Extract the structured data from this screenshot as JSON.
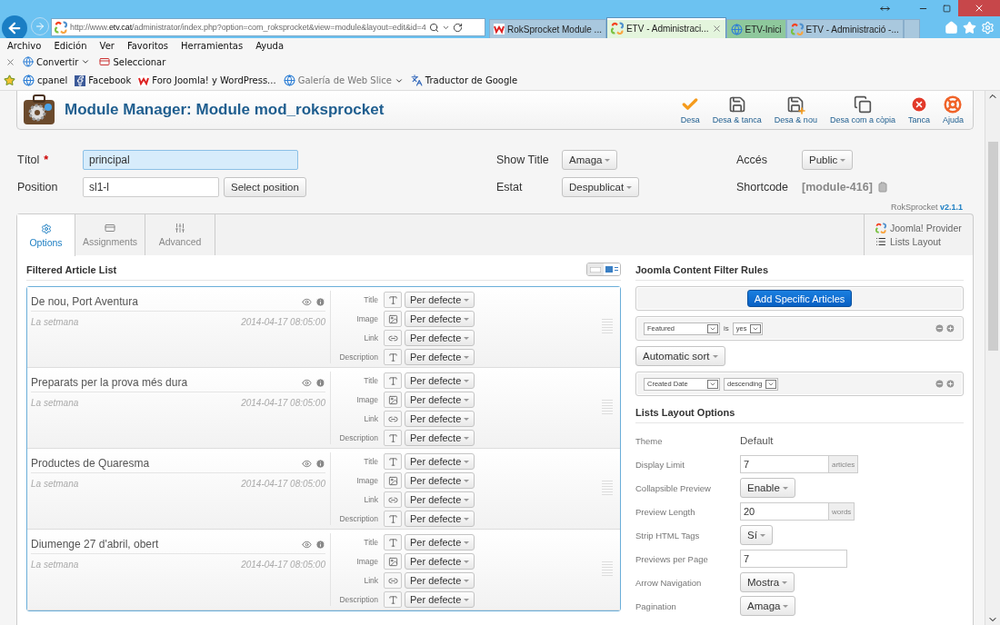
{
  "browser": {
    "url": "http://www.**etv.cat**/administrator/index.php?option=com_roksprocket&view=module&layout=edit&id=4",
    "tabs": [
      {
        "title": "RokSprocket Module ...",
        "kind": "rok",
        "selected": false,
        "color": "#a9c8de"
      },
      {
        "title": "ETV - Administraci...",
        "kind": "joomla",
        "selected": true,
        "color": "#e4f5dd"
      },
      {
        "title": "ETV-Inici",
        "kind": "ie",
        "selected": false,
        "color": "#8ec89c"
      },
      {
        "title": "ETV - Administració -...",
        "kind": "joomla",
        "selected": false,
        "color": "#a9c8de"
      }
    ],
    "menu": [
      "Archivo",
      "Edición",
      "Ver",
      "Favoritos",
      "Herramientas",
      "Ayuda"
    ],
    "commands": [
      {
        "label": "Convertir",
        "dropdown": true
      },
      {
        "label": "Seleccionar",
        "dropdown": false
      }
    ],
    "favorites": [
      {
        "label": "cpanel",
        "kind": "ie",
        "dropdown": false,
        "disabled": false
      },
      {
        "label": "Facebook",
        "kind": "facebook",
        "dropdown": false,
        "disabled": false
      },
      {
        "label": "Foro Joomla! y WordPress...",
        "kind": "rok",
        "dropdown": false,
        "disabled": false
      },
      {
        "label": "Galería de Web Slice",
        "kind": "ie",
        "dropdown": true,
        "disabled": true
      },
      {
        "label": "Traductor de Google",
        "kind": "translate",
        "dropdown": false,
        "disabled": false
      }
    ]
  },
  "header": {
    "title": "Module Manager: Module mod_roksprocket",
    "toolbar": [
      {
        "label": "Desa",
        "kind": "check"
      },
      {
        "label": "Desa & tanca",
        "kind": "save"
      },
      {
        "label": "Desa & nou",
        "kind": "save-new"
      },
      {
        "label": "Desa com a còpia",
        "kind": "save-copy"
      },
      {
        "label": "Tanca",
        "kind": "close"
      },
      {
        "label": "Ajuda",
        "kind": "help"
      }
    ]
  },
  "form": {
    "title_label": "Títol",
    "required_mark": "*",
    "title_value": "principal",
    "title_focused": true,
    "position_label": "Position",
    "position_value": "sl1-l",
    "position_button": "Select position",
    "show_title_label": "Show Title",
    "show_title_value": "Amaga",
    "state_label": "Estat",
    "state_value": "Despublicat",
    "access_label": "Accés",
    "access_value": "Public",
    "shortcode_label": "Shortcode",
    "shortcode_value": "[module-416]"
  },
  "version": {
    "name": "RokSprocket",
    "number": "v2.1.1"
  },
  "tabs": [
    {
      "label": "Options",
      "kind": "options",
      "selected": true
    },
    {
      "label": "Assignments",
      "kind": "assignments",
      "selected": false
    },
    {
      "label": "Advanced",
      "kind": "advanced",
      "selected": false
    }
  ],
  "provider": {
    "provider": "Joomla! Provider",
    "layout": "Lists Layout"
  },
  "article_list": {
    "title": "Filtered Article List",
    "views": [
      {
        "kind": "compact",
        "selected": false
      },
      {
        "kind": "expanded",
        "selected": true
      }
    ],
    "articles": [
      {
        "title": "De nou, Port Aventura",
        "category": "La setmana",
        "date": "2014-04-17 08:05:00",
        "fields": [
          {
            "label": "Title",
            "kind": "text",
            "value": "Per defecte"
          },
          {
            "label": "Image",
            "kind": "image",
            "value": "Per defecte"
          },
          {
            "label": "Link",
            "kind": "link",
            "value": "Per defecte"
          },
          {
            "label": "Description",
            "kind": "text",
            "value": "Per defecte"
          }
        ]
      },
      {
        "title": "Preparats per la prova més dura",
        "category": "La setmana",
        "date": "2014-04-17 08:05:00",
        "fields": [
          {
            "label": "Title",
            "kind": "text",
            "value": "Per defecte"
          },
          {
            "label": "Image",
            "kind": "image",
            "value": "Per defecte"
          },
          {
            "label": "Link",
            "kind": "link",
            "value": "Per defecte"
          },
          {
            "label": "Description",
            "kind": "text",
            "value": "Per defecte"
          }
        ]
      },
      {
        "title": "Productes de Quaresma",
        "category": "La setmana",
        "date": "2014-04-17 08:05:00",
        "fields": [
          {
            "label": "Title",
            "kind": "text",
            "value": "Per defecte"
          },
          {
            "label": "Image",
            "kind": "image",
            "value": "Per defecte"
          },
          {
            "label": "Link",
            "kind": "link",
            "value": "Per defecte"
          },
          {
            "label": "Description",
            "kind": "text",
            "value": "Per defecte"
          }
        ]
      },
      {
        "title": "Diumenge 27 d'abril, obert",
        "category": "La setmana",
        "date": "2014-04-17 08:05:00",
        "fields": [
          {
            "label": "Title",
            "kind": "text",
            "value": "Per defecte"
          },
          {
            "label": "Image",
            "kind": "image",
            "value": "Per defecte"
          },
          {
            "label": "Link",
            "kind": "link",
            "value": "Per defecte"
          },
          {
            "label": "Description",
            "kind": "text",
            "value": "Per defecte"
          }
        ]
      }
    ]
  },
  "filter_rules": {
    "title": "Joomla Content Filter Rules",
    "add_button": "Add Specific Articles",
    "rules": [
      {
        "field": "Featured",
        "operator": "is",
        "value": "yes"
      }
    ],
    "sort": "Automatic sort",
    "sort_rules": [
      {
        "field": "Created Date",
        "value": "descending"
      }
    ]
  },
  "layout_options": {
    "title": "Lists Layout Options",
    "rows": [
      {
        "label": "Theme",
        "kind": "static",
        "value": "Default"
      },
      {
        "label": "Display Limit",
        "kind": "input",
        "value": "7",
        "suffix": "articles"
      },
      {
        "label": "Collapsible Preview",
        "kind": "dropdown",
        "value": "Enable"
      },
      {
        "label": "Preview Length",
        "kind": "input",
        "value": "20",
        "suffix": "words"
      },
      {
        "label": "Strip HTML Tags",
        "kind": "dropdown",
        "value": "Sí"
      },
      {
        "label": "Previews per Page",
        "kind": "input",
        "value": "7"
      },
      {
        "label": "Arrow Navigation",
        "kind": "dropdown",
        "value": "Mostra"
      },
      {
        "label": "Pagination",
        "kind": "dropdown",
        "value": "Amaga"
      }
    ]
  }
}
